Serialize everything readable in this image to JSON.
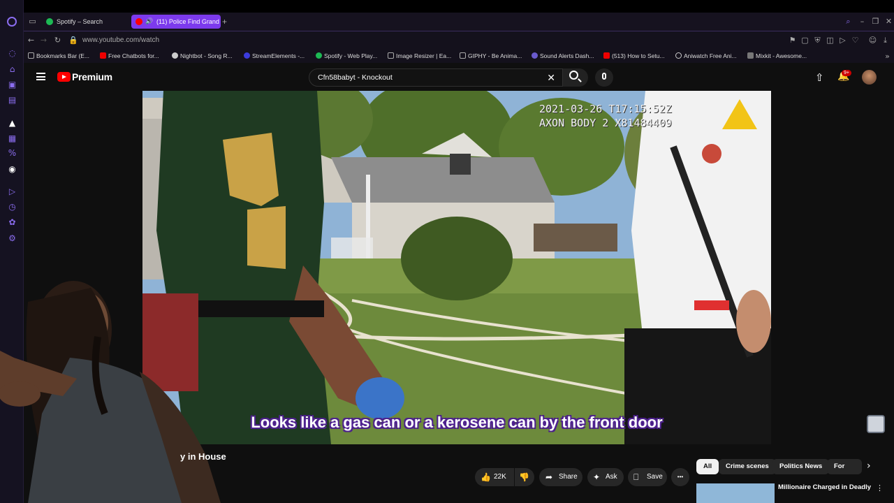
{
  "browser": {
    "tabs": [
      {
        "label": "Spotify – Search",
        "color": "#1db954"
      },
      {
        "label": "(11) Police Find Grand",
        "color": "#ff0000"
      }
    ],
    "new_tab": "+",
    "url": "www.youtube.com/watch",
    "bookmarks": [
      "Bookmarks Bar (E...",
      "Free Chatbots for...",
      "Nightbot - Song R...",
      "StreamElements -...",
      "Spotify - Web Play...",
      "Image Resizer | Ea...",
      "GIPHY - Be Anima...",
      "Sound Alerts Dash...",
      "(513) How to Setu...",
      "Aniwatch Free Ani...",
      "Mixkit - Awesome..."
    ]
  },
  "youtube": {
    "brand": "Premium",
    "search_value": "Cfn58babyt - Knockout",
    "notif_badge": "9+"
  },
  "video": {
    "timestamp_line1": "2021-03-26 T17:15:52Z",
    "timestamp_line2": "AXON BODY 2 X81484409",
    "subtitle": "Looks like a gas can or a kerosene can by the front door"
  },
  "below": {
    "title_fragment": "y in House",
    "likes": "22K",
    "share": "Share",
    "ask": "Ask",
    "save": "Save",
    "more": "•••"
  },
  "chips": [
    "All",
    "Crime scenes",
    "Politics News",
    "For you"
  ],
  "recommendation": {
    "title": "Millionaire Charged in Deadly"
  }
}
